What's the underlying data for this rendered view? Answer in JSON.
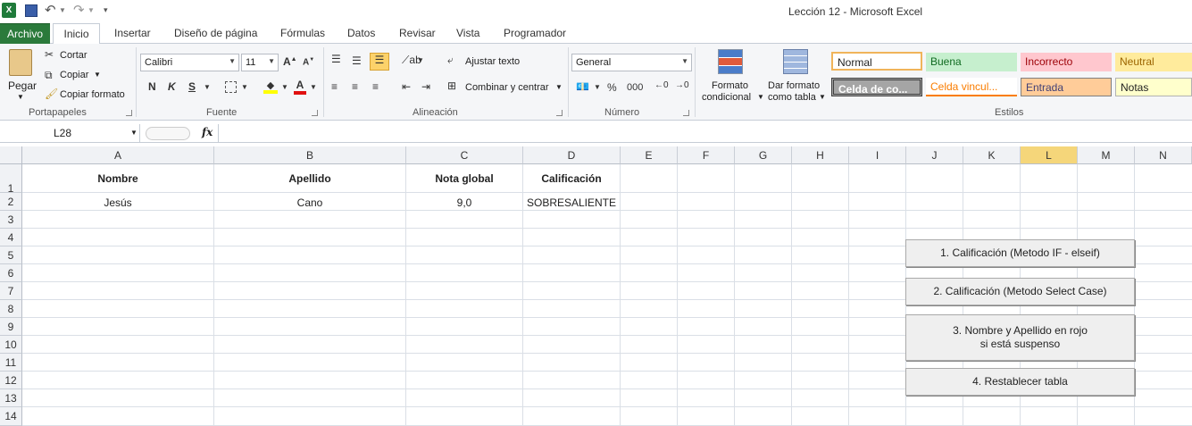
{
  "window": {
    "title": "Lección 12  -  Microsoft Excel"
  },
  "qat": {
    "excel_icon": "excel-icon",
    "save_icon": "save-icon",
    "undo_icon": "undo-icon",
    "redo_icon": "redo-icon"
  },
  "tabs": [
    "Archivo",
    "Inicio",
    "Insertar",
    "Diseño de página",
    "Fórmulas",
    "Datos",
    "Revisar",
    "Vista",
    "Programador"
  ],
  "ribbon": {
    "clipboard": {
      "label": "Portapapeles",
      "paste": "Pegar",
      "cut": "Cortar",
      "copy": "Copiar",
      "format_painter": "Copiar formato"
    },
    "font": {
      "label": "Fuente",
      "name": "Calibri",
      "size": "11",
      "bold": "N",
      "italic": "K",
      "underline": "S"
    },
    "alignment": {
      "label": "Alineación",
      "wrap": "Ajustar texto",
      "merge": "Combinar y centrar"
    },
    "number": {
      "label": "Número",
      "format": "General",
      "percent": "%",
      "thousands": "000"
    },
    "cond": {
      "line1": "Formato",
      "line2": "condicional"
    },
    "table": {
      "line1": "Dar formato",
      "line2": "como tabla"
    },
    "styles": {
      "label": "Estilos",
      "items": [
        "Normal",
        "Buena",
        "Incorrecto",
        "Neutral",
        "Celda de co...",
        "Celda vincul...",
        "Entrada",
        "Notas"
      ]
    }
  },
  "formula_bar": {
    "name_box": "L28",
    "fx": "fx",
    "formula": ""
  },
  "columns": [
    "A",
    "B",
    "C",
    "D",
    "E",
    "F",
    "G",
    "H",
    "I",
    "J",
    "K",
    "L",
    "M",
    "N"
  ],
  "rows": [
    "1",
    "2",
    "3",
    "4",
    "5",
    "6",
    "7",
    "8",
    "9",
    "10",
    "11",
    "12",
    "13",
    "14"
  ],
  "table": {
    "headers": [
      "Nombre",
      "Apellido",
      "Nota global",
      "Calificación"
    ],
    "row2": [
      "Jesús",
      "Cano",
      "9,0",
      "SOBRESALIENTE"
    ]
  },
  "macro_buttons": [
    "1. Calificación (Metodo IF - elseif)",
    "2. Calificación (Metodo Select Case)",
    "3. Nombre y Apellido en rojo",
    "si está suspenso",
    "4. Restablecer tabla"
  ],
  "colors": {
    "file_tab": "#2b7a3b",
    "selected_col": "#f5d67a"
  }
}
